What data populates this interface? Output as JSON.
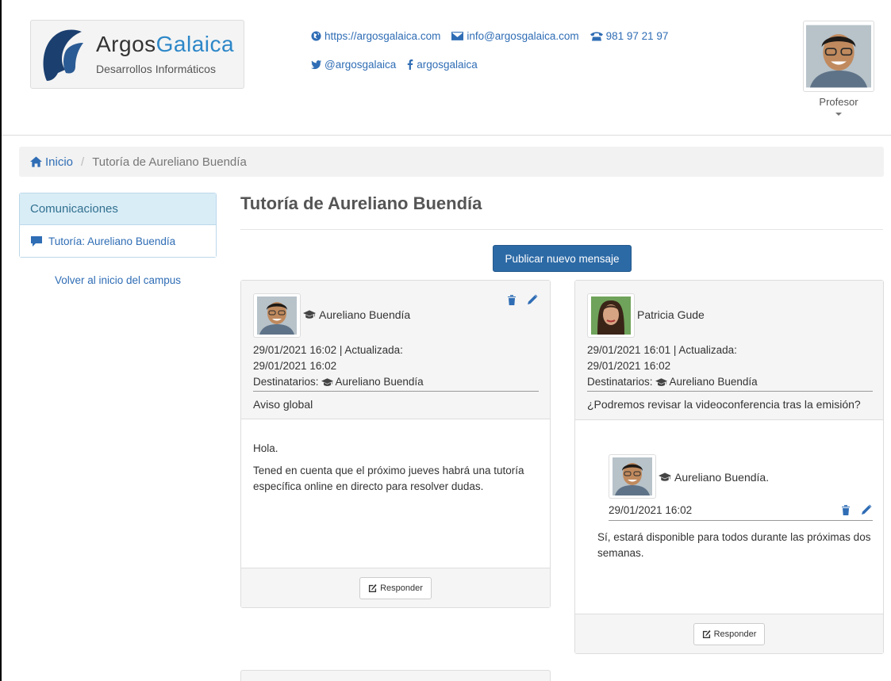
{
  "logo": {
    "name_part1": "Argos",
    "name_part2": "Galaica",
    "tagline": "Desarrollos Informáticos"
  },
  "contacts": {
    "website": "https://argosgalaica.com",
    "email": "info@argosgalaica.com",
    "phone": "981 97 21 97",
    "twitter": "@argosgalaica",
    "facebook": "argosgalaica"
  },
  "profile": {
    "role": "Profesor"
  },
  "breadcrumb": {
    "home": "Inicio",
    "current": "Tutoría de Aureliano Buendía"
  },
  "sidebar": {
    "heading": "Comunicaciones",
    "items": [
      {
        "label": "Tutoría: Aureliano Buendía"
      }
    ],
    "back_link": "Volver al inicio del campus"
  },
  "main": {
    "title": "Tutoría de Aureliano Buendía",
    "publish_button": "Publicar nuevo mensaje",
    "reply_label": "Responder",
    "recipients_label": "Destinatarios:",
    "messages": [
      {
        "author": "Aureliano Buendía",
        "date_line": "29/01/2021 16:02 | Actualizada:",
        "updated": "29/01/2021 16:02",
        "recipient": "Aureliano Buendía",
        "subject": "Aviso global",
        "body": [
          "Hola.",
          "Tened en cuenta que el próximo jueves habrá una tutoría específica online en directo para resolver dudas."
        ]
      },
      {
        "author": "Patricia Gude",
        "date_line": "29/01/2021 16:01 | Actualizada:",
        "updated": "29/01/2021 16:02",
        "recipient": "Aureliano Buendía",
        "subject": "¿Podremos revisar la videoconferencia tras la emisión?",
        "reply": {
          "author": "Aureliano Buendía.",
          "date": "29/01/2021 16:02",
          "body": "Sí, estará disponible para todos durante las próximas dos semanas."
        }
      }
    ]
  },
  "icons": {
    "globe": "globe-icon",
    "mail": "envelope-icon",
    "phone": "phone-icon",
    "twitter": "twitter-icon",
    "facebook": "facebook-icon",
    "home": "home-icon",
    "comment": "comment-icon",
    "teacher": "graduation-cap-icon",
    "trash": "trash-icon",
    "edit": "pencil-icon",
    "reply": "edit-square-icon"
  },
  "colors": {
    "link": "#2f6db5",
    "primary_button": "#2c6aa6",
    "sidebar_head": "#d9edf7"
  }
}
